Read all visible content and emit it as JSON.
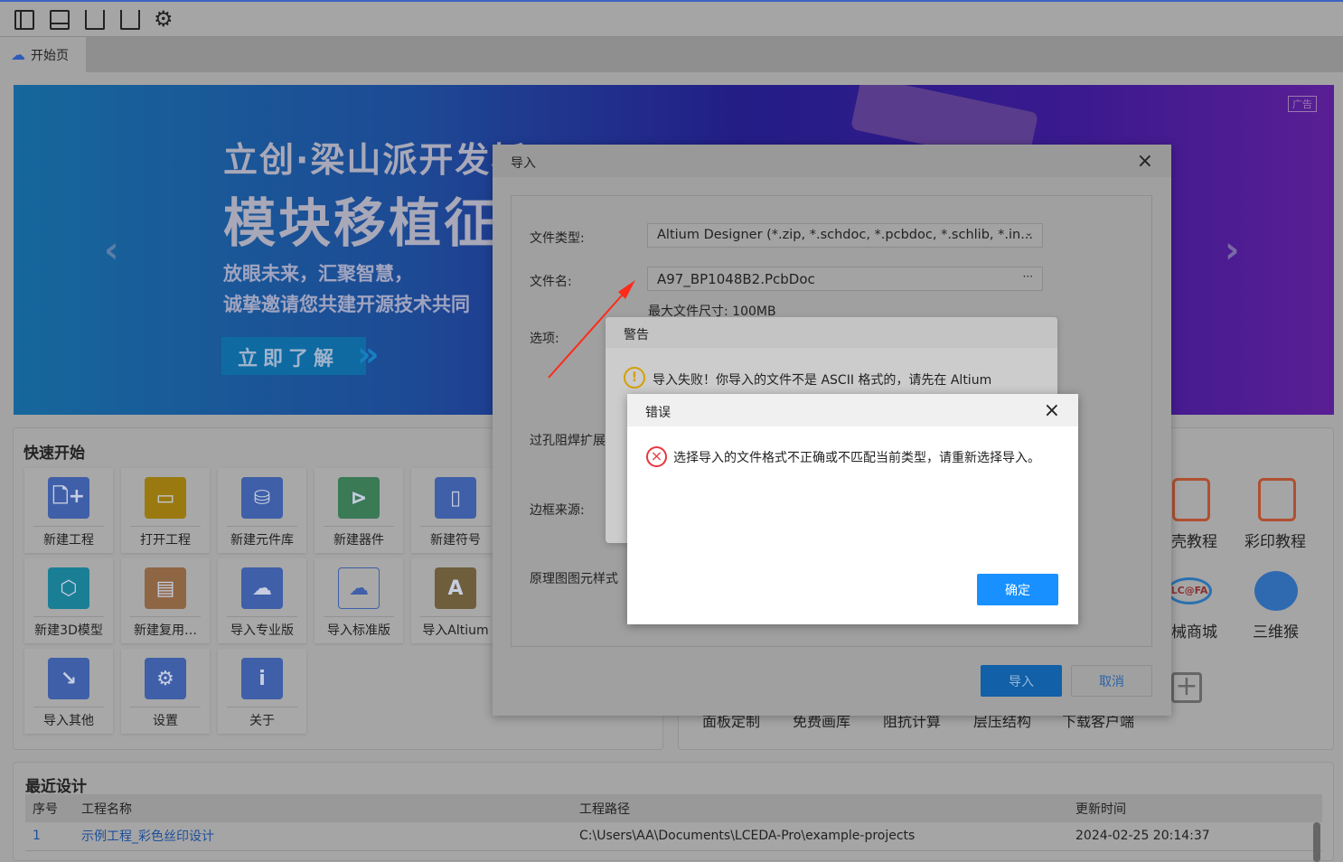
{
  "toolbar": {
    "icons": [
      "left-panel-icon",
      "bottom-panel-icon",
      "cart-device-icon",
      "cart-store-icon",
      "gear-icon"
    ]
  },
  "tabs": [
    {
      "label": "开始页",
      "icon": "cloud-icon"
    }
  ],
  "banner": {
    "title1": "立创·梁山派开发板",
    "title2": "模块移植征",
    "line1": "放眼未来，汇聚智慧，",
    "line2": "诚挚邀请您共建开源技术共同",
    "cta": "立即了解",
    "ad": "广告"
  },
  "quick_start": {
    "title": "快速开始",
    "tiles": [
      {
        "label": "新建工程",
        "icon": "new-project-icon",
        "color": "#3f5fa8"
      },
      {
        "label": "打开工程",
        "icon": "open-folder-icon",
        "color": "#9a7a10"
      },
      {
        "label": "新建元件库",
        "icon": "new-library-icon",
        "color": "#3f5fa8"
      },
      {
        "label": "新建器件",
        "icon": "new-device-icon",
        "color": "#3a7a55"
      },
      {
        "label": "新建符号",
        "icon": "new-symbol-icon",
        "color": "#3f5fa8"
      },
      {
        "label": "新建3D模型",
        "icon": "new-3d-model-icon",
        "color": "#1a7f95"
      },
      {
        "label": "新建复用…",
        "icon": "new-reuse-icon",
        "color": "#8f6644"
      },
      {
        "label": "导入专业版",
        "icon": "import-pro-icon",
        "color": "#3f5fa8"
      },
      {
        "label": "导入标准版",
        "icon": "import-std-icon",
        "color": "#a8a8a8"
      },
      {
        "label": "导入Altium",
        "icon": "import-altium-icon",
        "color": "#6f5e3c"
      },
      {
        "label": "导入其他",
        "icon": "import-more-icon",
        "color": "#3f5fa8"
      },
      {
        "label": "设置",
        "icon": "settings-icon",
        "color": "#3f5fa8"
      },
      {
        "label": "关于",
        "icon": "about-icon",
        "color": "#3f5fa8"
      }
    ]
  },
  "right_links": {
    "row1": [
      "壳教程",
      "彩印教程"
    ],
    "row2": [
      "械商城",
      "三维猴"
    ],
    "bottom": [
      "面板定制",
      "免费画库",
      "阻抗计算",
      "层压结构",
      "下载客户端"
    ]
  },
  "recent": {
    "title": "最近设计",
    "columns": [
      "序号",
      "工程名称",
      "工程路径",
      "更新时间"
    ],
    "rows": [
      [
        "1",
        "示例工程_彩色丝印设计",
        "C:\\Users\\AA\\Documents\\LCEDA-Pro\\example-projects",
        "2024-02-25 20:14:37"
      ]
    ]
  },
  "import_dialog": {
    "title": "导入",
    "file_type_label": "文件类型:",
    "file_type_value": "Altium Designer (*.zip, *.schdoc, *.pcbdoc, *.schlib, *.in...",
    "file_name_label": "文件名:",
    "file_name_value": "A97_BP1048B2.PcbDoc",
    "browse": "···",
    "max_size": "最大文件尺寸: 100MB",
    "options_label": "选项:",
    "via_label": "过孔阻焊扩展",
    "frame_label": "边框来源:",
    "style_label": "原理图图元样式",
    "import_button": "导入",
    "cancel_button": "取消",
    "close": "×"
  },
  "warning_dialog": {
    "title": "警告",
    "message": "导入失败！你导入的文件不是 ASCII 格式的，请先在 Altium"
  },
  "error_dialog": {
    "title": "错误",
    "message": "选择导入的文件格式不正确或不匹配当前类型，请重新选择导入。",
    "ok": "确定",
    "close": "×"
  },
  "colors": {
    "primary": "#1890ff",
    "error": "#e8383d",
    "warning": "#d4a000",
    "arrow": "#ff2a1a"
  }
}
